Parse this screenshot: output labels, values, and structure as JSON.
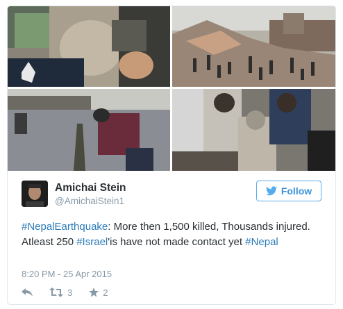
{
  "media": {
    "photos": [
      {
        "name": "photo-rescue-people"
      },
      {
        "name": "photo-collapsed-buildings"
      },
      {
        "name": "photo-street-crack"
      },
      {
        "name": "photo-rescued-survivor"
      }
    ]
  },
  "tweet": {
    "author_name": "Amichai Stein",
    "author_handle": "@AmichaiStein1",
    "follow_label": "Follow",
    "text_parts": {
      "hashtag_nepal_earthquake": "#NepalEarthquake",
      "part1": ": More then 1,500 killed, Thousands injured. Atleast 250 ",
      "hashtag_israel": "#Israel",
      "part2": "'is have not made contact yet ",
      "hashtag_nepal": "#Nepal"
    },
    "timestamp": "8:20 PM - 25 Apr 2015",
    "actions": {
      "reply_icon": "reply-icon",
      "retweet_icon": "retweet-icon",
      "retweet_count": "3",
      "favorite_icon": "star-icon",
      "favorite_count": "2"
    }
  },
  "colors": {
    "link": "#2b7bb9",
    "follow_border": "#55acee",
    "muted": "#8899a6",
    "text": "#292f33"
  }
}
